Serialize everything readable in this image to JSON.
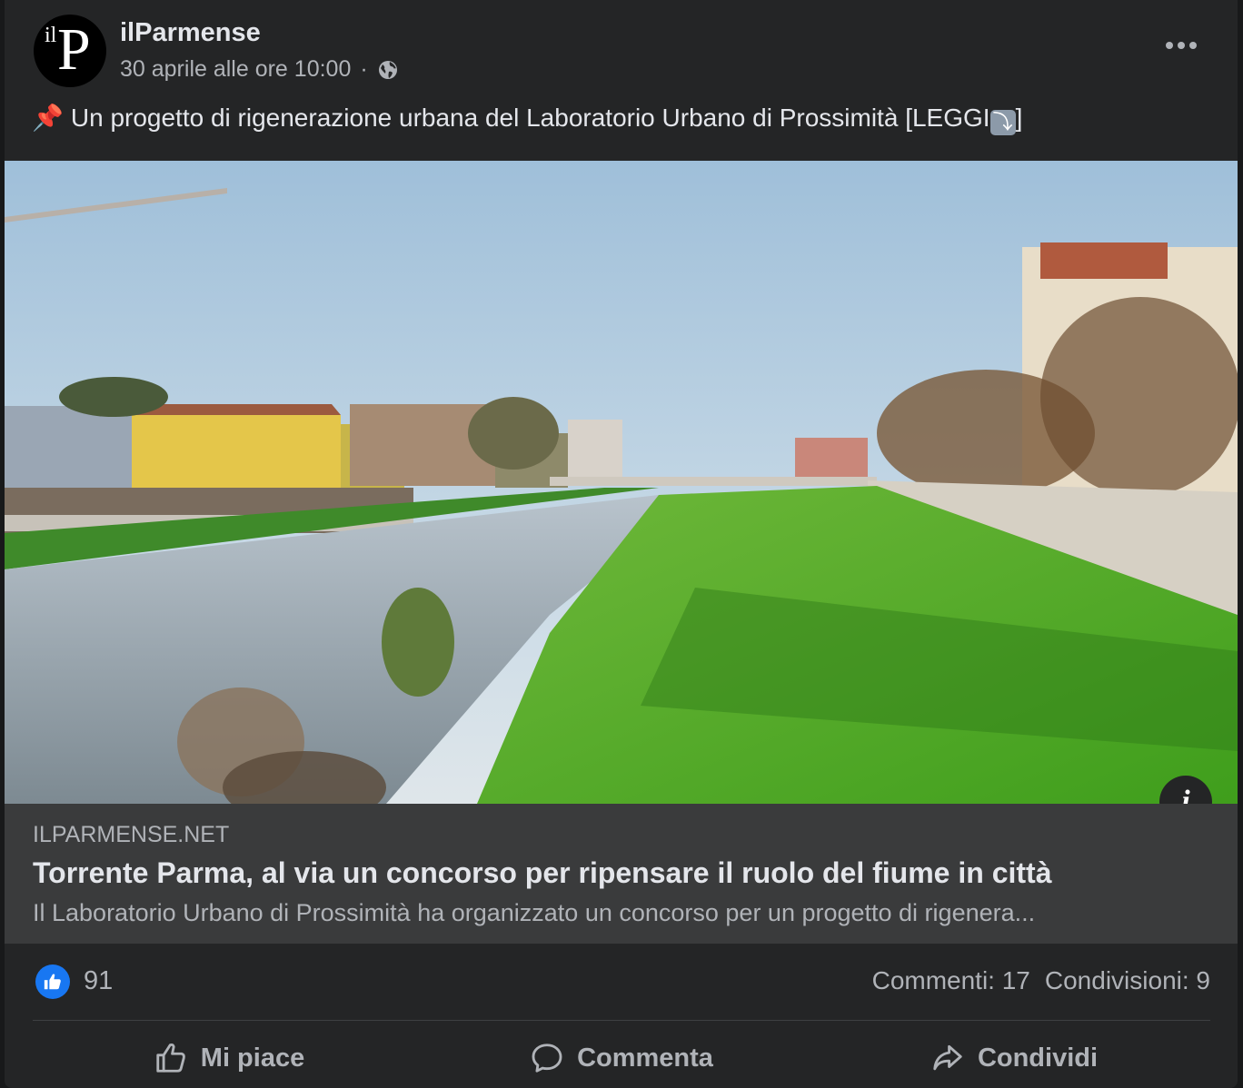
{
  "header": {
    "avatar": {
      "small_text": "il",
      "big_text": "P"
    },
    "page_name": "ilParmense",
    "timestamp": "30 aprile alle ore 10:00",
    "separator": "·",
    "privacy_icon": "globe-icon",
    "more_icon": "more-options-icon"
  },
  "post": {
    "pin_icon": "📌",
    "text": "Un progetto di rigenerazione urbana del Laboratorio Urbano di Prossimità [LEGGI",
    "text_arrow": "⤵",
    "text_end": "]"
  },
  "link_preview": {
    "domain": "ILPARMENSE.NET",
    "title": "Torrente Parma, al via un concorso per ripensare il ruolo del fiume in città",
    "description": "Il Laboratorio Urbano di Prossimità ha organizzato un concorso per un progetto di rigenera...",
    "info_icon": "i"
  },
  "stats": {
    "like_count": "91",
    "comments": "Commenti: 17",
    "shares": "Condivisioni: 9"
  },
  "actions": {
    "like": "Mi piace",
    "comment": "Commenta",
    "share": "Condividi"
  },
  "colors": {
    "background": "#242526",
    "link_box": "#3a3b3c",
    "primary_text": "#e4e6eb",
    "secondary_text": "#b0b3b8",
    "like_blue": "#1877f2"
  }
}
